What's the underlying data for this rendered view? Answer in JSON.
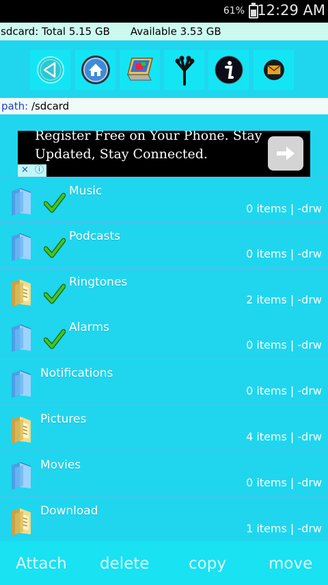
{
  "status_bar": {
    "battery": "61%",
    "time": "12:29 AM"
  },
  "storage": {
    "total": "sdcard: Total 5.15 GB",
    "available": "Available 3.53 GB"
  },
  "toolbar": {
    "buttons": [
      {
        "icon": "back-arrow-icon"
      },
      {
        "icon": "home-icon"
      },
      {
        "icon": "computer-icon"
      },
      {
        "icon": "tree-branch-icon"
      },
      {
        "icon": "info-icon"
      },
      {
        "icon": "mail-icon"
      }
    ]
  },
  "path": {
    "label": "path:",
    "value": "/sdcard"
  },
  "ad": {
    "text": "Register Free on Your Phone. Stay Updated, Stay Connected.",
    "close": "✕",
    "info": "ⓘ"
  },
  "files": [
    {
      "name": "Music",
      "meta": "0 items | -drw",
      "icon": "blue-folder-icon",
      "checked": true
    },
    {
      "name": "Podcasts",
      "meta": "0 items | -drw",
      "icon": "blue-folder-icon",
      "checked": true
    },
    {
      "name": "Ringtones",
      "meta": "2 items | -drw",
      "icon": "yellow-folder-icon",
      "checked": true
    },
    {
      "name": "Alarms",
      "meta": "0 items | -drw",
      "icon": "blue-folder-icon",
      "checked": true
    },
    {
      "name": "Notifications",
      "meta": "0 items | -drw",
      "icon": "blue-folder-icon",
      "checked": false
    },
    {
      "name": "Pictures",
      "meta": "4 items | -drw",
      "icon": "yellow-folder-icon",
      "checked": false
    },
    {
      "name": "Movies",
      "meta": "0 items | -drw",
      "icon": "blue-folder-icon",
      "checked": false
    },
    {
      "name": "Download",
      "meta": "1 items | -drw",
      "icon": "yellow-folder-icon",
      "checked": false
    }
  ],
  "actions": {
    "attach": "Attach",
    "delete": "delete",
    "copy": "copy",
    "move": "move"
  },
  "colors": {
    "background": "#1fd6ee",
    "row_divider": "#67b4ef",
    "check": "#2bb51c"
  }
}
